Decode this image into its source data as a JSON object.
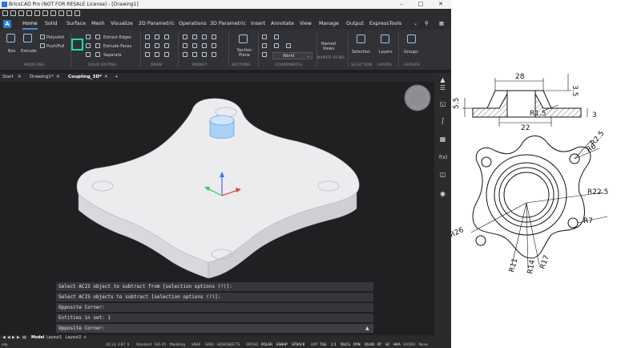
{
  "window": {
    "title": "BricsCAD Pro (NOT FOR RESALE License) - [Drawing1]",
    "controls": [
      "–",
      "□",
      "✕"
    ]
  },
  "menu": {
    "logo": "A",
    "tabs": [
      "Home",
      "Solid",
      "Surface",
      "Mesh",
      "Visualize",
      "2D Parametric",
      "Operations",
      "3D Parametric",
      "Insert",
      "Annotate",
      "View",
      "Manage",
      "Output",
      "ExpressTools"
    ],
    "active": "Home"
  },
  "ribbon": {
    "box": "Box",
    "extrude": "Extrude",
    "polysolid": "Polysolid",
    "pushpull": "Push/Pull",
    "extract_edges": "Extract Edges",
    "extrude_faces": "Extrude Faces",
    "separate": "Separate",
    "section_plane": "Section Plane",
    "world": "World",
    "named_views": "Named Views",
    "selection": "Selection",
    "layers": "Layers",
    "groups": "Groups",
    "groups_labels": [
      "MODELING",
      "SOLID EDITING",
      "DRAW",
      "MODIFY",
      "SECTIONS",
      "COORDINATES",
      "NAMED VIEWS",
      "SELECTION",
      "LAYERS",
      "GROUPS"
    ]
  },
  "doc_tabs": {
    "start": "Start",
    "tabs": [
      "Drawing1*",
      "Coupling_3D*"
    ],
    "active": "Coupling_3D*",
    "add": "+"
  },
  "command_lines": [
    "Select ACIS object to subtract from [selection options (?)]:",
    "Select ACIS objects to subtract [selection options (?)]:",
    "Opposite Corner:",
    "Entities in set: 1",
    "Opposite Corner:"
  ],
  "layout_tabs": [
    "Model",
    "Layout1",
    "Layout2",
    "+"
  ],
  "status": {
    "ready": "ady",
    "coords": "26.14, 4.87, 0",
    "items": [
      "Standard",
      "ISO-25",
      "Modeling",
      "SNAP",
      "GRID",
      "HIDEOBJECTS",
      "ORTHO",
      "POLAR",
      "ESNAP",
      "STRACK",
      "LWT",
      "TILE",
      "1:1",
      "DUCS",
      "DYN",
      "QUAD",
      "RT",
      "SC",
      "HKA",
      "LOCKUI",
      "None"
    ]
  },
  "drawing_dims": {
    "d28": "28",
    "d35": "3.5",
    "d55": "5.5",
    "r15": "R1.5",
    "d22": "22",
    "d3": "3",
    "r25": "R2.5",
    "r6": "R6",
    "r225": "R22.5",
    "r7": "R7",
    "r26": "R26",
    "r11": "R11",
    "r14": "R14",
    "r17": "R17"
  },
  "colors": {
    "accent": "#3d8fe0",
    "highlight": "#19e0a4",
    "part_face": "#e9e9ec",
    "boss": "#9cc7f0"
  }
}
